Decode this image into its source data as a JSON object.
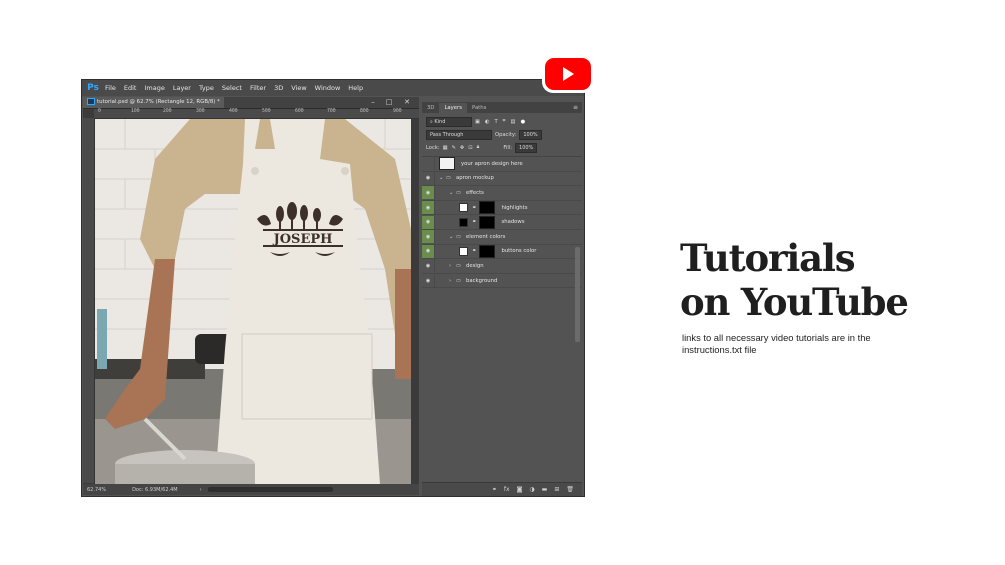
{
  "app": {
    "logo_text": "Ps",
    "menu": [
      "File",
      "Edit",
      "Image",
      "Layer",
      "Type",
      "Select",
      "Filter",
      "3D",
      "View",
      "Window",
      "Help"
    ]
  },
  "document": {
    "tab_title": "tutorial.psd @ 62.7% (Rectangle 12, RGB/8) *",
    "ruler_ticks": [
      "0",
      "100",
      "200",
      "300",
      "400",
      "500",
      "600",
      "700",
      "800",
      "900"
    ],
    "zoom": "62.74%",
    "doc_size": "Doc: 6.93M/62.4M",
    "mockup_name": "JOSEPH"
  },
  "panel": {
    "tabs": [
      "3D",
      "Layers",
      "Paths"
    ],
    "active_tab": "Layers",
    "filter_label": "Kind",
    "blend_mode": "Pass Through",
    "opacity_label": "Opacity:",
    "opacity_value": "100%",
    "lock_label": "Lock:",
    "fill_label": "Fill:",
    "fill_value": "100%",
    "layers": [
      {
        "name": "your apron design here",
        "indent": 0,
        "type": "smart",
        "visible": false,
        "expanded": false
      },
      {
        "name": "apron mockup",
        "indent": 0,
        "type": "group",
        "visible": true,
        "expanded": true
      },
      {
        "name": "effects",
        "indent": 1,
        "type": "group",
        "visible": true,
        "expanded": true,
        "green": true
      },
      {
        "name": "highlights",
        "indent": 2,
        "type": "layer",
        "visible": true,
        "green": true
      },
      {
        "name": "shadows",
        "indent": 2,
        "type": "layer",
        "visible": true,
        "green": true
      },
      {
        "name": "element colors",
        "indent": 1,
        "type": "group",
        "visible": true,
        "expanded": true,
        "green": true
      },
      {
        "name": "buttons color",
        "indent": 2,
        "type": "layer",
        "visible": true,
        "green": true
      },
      {
        "name": "design",
        "indent": 1,
        "type": "group",
        "visible": true,
        "expanded": false
      },
      {
        "name": "background",
        "indent": 1,
        "type": "group",
        "visible": true,
        "expanded": false
      }
    ]
  },
  "promo": {
    "title_line1": "Tutorials",
    "title_line2": "on YouTube",
    "subtitle": "links to all necessary video tutorials are in the instructions.txt file"
  },
  "colors": {
    "youtube_red": "#ff0000",
    "visibility_green": "#6a8c4c",
    "ps_blue": "#31a8ff"
  }
}
